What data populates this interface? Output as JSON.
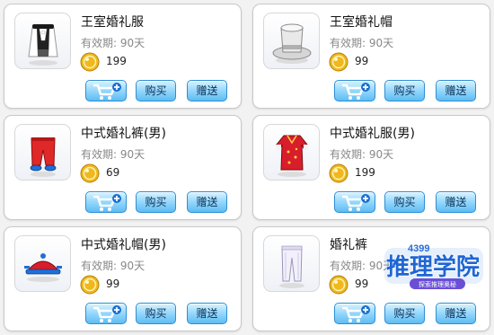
{
  "colors": {
    "button_top": "#d7f3ff",
    "button_bottom": "#5fbcf2",
    "button_border": "#2d8fd6",
    "coin": "#f0b81e",
    "logo_blue": "#1f66d3"
  },
  "items": [
    {
      "name": "王室婚礼服",
      "validity": "有效期: 90天",
      "price": "199",
      "icon": "royal-wedding-suit-icon",
      "cart_icon": "add-to-cart-icon",
      "buy_label": "购买",
      "gift_label": "赠送"
    },
    {
      "name": "王室婚礼帽",
      "validity": "有效期: 90天",
      "price": "99",
      "icon": "royal-wedding-hat-icon",
      "cart_icon": "add-to-cart-icon",
      "buy_label": "购买",
      "gift_label": "赠送"
    },
    {
      "name": "中式婚礼裤(男)",
      "validity": "有效期: 90天",
      "price": "69",
      "icon": "chinese-wedding-pants-icon",
      "cart_icon": "add-to-cart-icon",
      "buy_label": "购买",
      "gift_label": "赠送"
    },
    {
      "name": "中式婚礼服(男)",
      "validity": "有效期: 90天",
      "price": "199",
      "icon": "chinese-wedding-robe-icon",
      "cart_icon": "add-to-cart-icon",
      "buy_label": "购买",
      "gift_label": "赠送"
    },
    {
      "name": "中式婚礼帽(男)",
      "validity": "有效期: 90天",
      "price": "99",
      "icon": "chinese-wedding-hat-icon",
      "cart_icon": "add-to-cart-icon",
      "buy_label": "购买",
      "gift_label": "赠送"
    },
    {
      "name": "婚礼裤",
      "validity": "有效期: 90天",
      "price": "99",
      "icon": "wedding-pants-icon",
      "cart_icon": "add-to-cart-icon",
      "buy_label": "购买",
      "gift_label": "赠送"
    }
  ],
  "watermark": {
    "brand": "4399",
    "name": "推理学院",
    "subtitle": "探索推理奥秘"
  }
}
